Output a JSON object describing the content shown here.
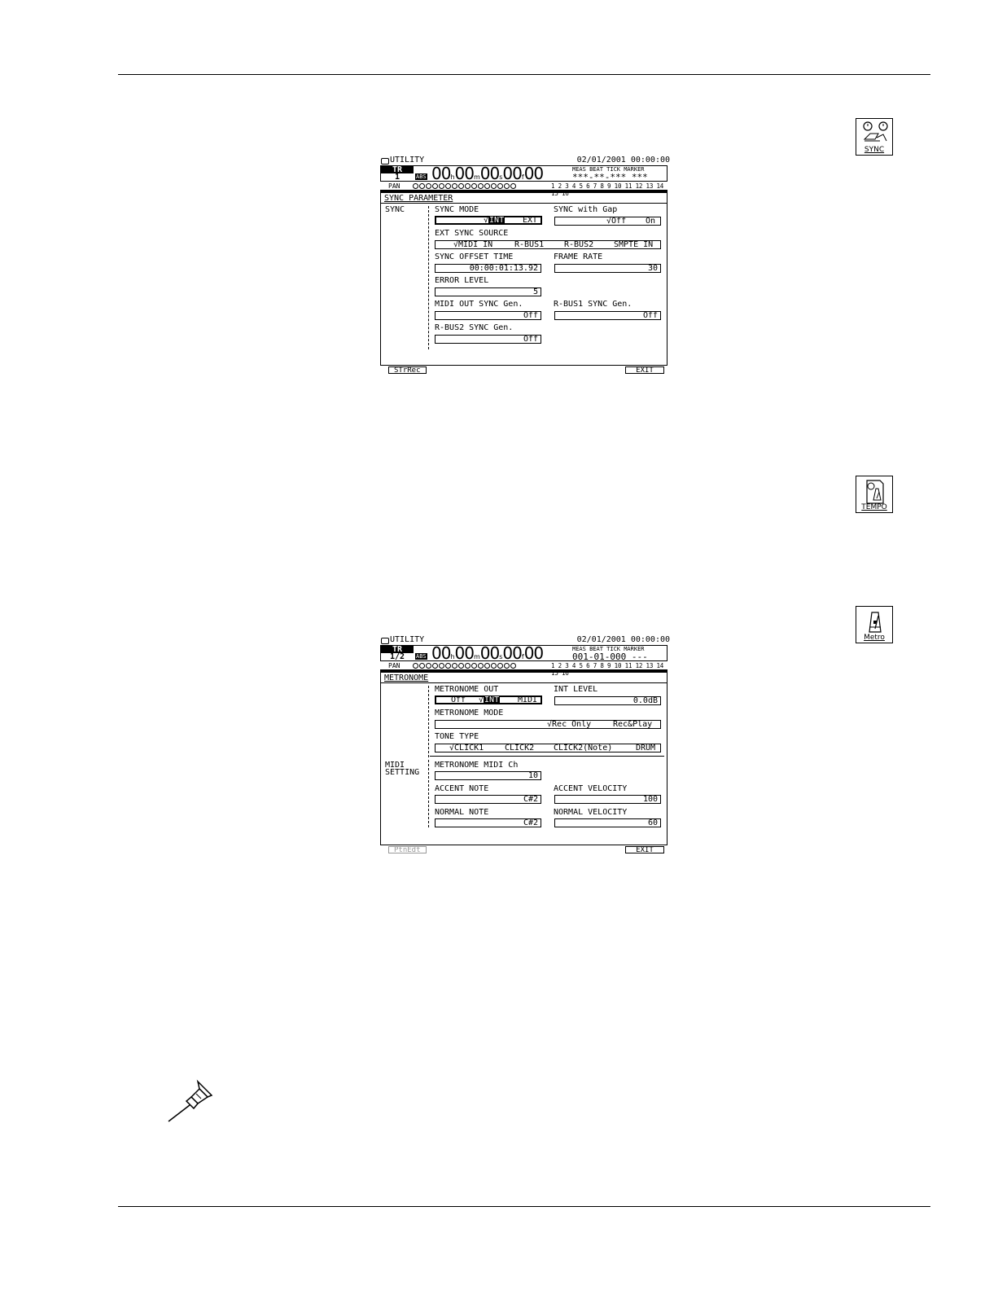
{
  "icons": {
    "sync": {
      "label": "SYNC",
      "icon": "sync-clocks-icon"
    },
    "tempo": {
      "label": "TEMPO",
      "icon": "tempo-map-icon"
    },
    "metro": {
      "label": "Metro",
      "icon": "metronome-icon"
    }
  },
  "screen1": {
    "title": "UTILITY",
    "date": "02/01/2001 00:00:00",
    "tr_label": "TR",
    "tr_num": "1",
    "abs": "ABS",
    "time": {
      "h": "00",
      "m": "00",
      "s": "00",
      "f": "00",
      "sub": "00",
      "h_unit": "h",
      "m_unit": "m",
      "s_unit": "s",
      "f_unit": "f"
    },
    "mbt_labels": "MEAS BEAT TICK MARKER",
    "mbt_value": "***-**-*** ***",
    "pan": "PAN",
    "tracks": "1 2 3 4 5 6 7 8 9 10 11 12 13 14 15 16",
    "panel_title": "SYNC PARAMETER",
    "section": "SYNC",
    "sync_mode": {
      "label": "SYNC MODE",
      "opt1": "INT",
      "opt2": "EXT"
    },
    "sync_gap": {
      "label": "SYNC with Gap",
      "opt1": "Off",
      "opt2": "On"
    },
    "ext_source": {
      "label": "EXT SYNC SOURCE",
      "opt1": "MIDI IN",
      "opt2": "R-BUS1",
      "opt3": "R-BUS2",
      "opt4": "SMPTE IN"
    },
    "offset": {
      "label": "SYNC OFFSET TIME",
      "value": "00:00:01:13.92"
    },
    "frame_rate": {
      "label": "FRAME RATE",
      "value": "30"
    },
    "error_level": {
      "label": "ERROR LEVEL",
      "value": "5"
    },
    "midi_out_gen": {
      "label": "MIDI OUT SYNC Gen.",
      "value": "Off"
    },
    "rbus1_gen": {
      "label": "R-BUS1 SYNC Gen.",
      "value": "Off"
    },
    "rbus2_gen": {
      "label": "R-BUS2 SYNC Gen.",
      "value": "Off"
    },
    "btn_left": "STrRec",
    "btn_right": "EXIT"
  },
  "screen2": {
    "title": "UTILITY",
    "date": "02/01/2001 00:00:00",
    "tr_label": "TR",
    "tr_num": "1/2",
    "abs": "ABS",
    "time": {
      "h": "00",
      "m": "00",
      "s": "00",
      "f": "00",
      "sub": "00",
      "h_unit": "h",
      "m_unit": "m",
      "s_unit": "s",
      "f_unit": "f"
    },
    "mbt_labels": "MEAS BEAT TICK MARKER",
    "mbt_value": "001-01-000 ---",
    "pan": "PAN",
    "tracks": "1 2 3 4 5 6 7 8 9 10 11 12 13 14 15 16",
    "panel_title": "METRONOME",
    "met_out": {
      "label": "METRONOME OUT",
      "opt1": "Off",
      "opt2": "INT",
      "opt3": "MIDI"
    },
    "int_level": {
      "label": "INT LEVEL",
      "value": "0.0dB"
    },
    "met_mode": {
      "label": "METRONOME MODE",
      "opt1": "Rec Only",
      "opt2": "Rec&Play"
    },
    "tone_type": {
      "label": "TONE TYPE",
      "opt1": "CLICK1",
      "opt2": "CLICK2",
      "opt3": "CLICK2(Note)",
      "opt4": "DRUM"
    },
    "section_midi_1": "MIDI",
    "section_midi_2": "SETTING",
    "midi_ch": {
      "label": "METRONOME MIDI Ch",
      "value": "10"
    },
    "accent_note": {
      "label": "ACCENT NOTE",
      "value": "C#2"
    },
    "accent_vel": {
      "label": "ACCENT VELOCITY",
      "value": "100"
    },
    "normal_note": {
      "label": "NORMAL NOTE",
      "value": "C#2"
    },
    "normal_vel": {
      "label": "NORMAL VELOCITY",
      "value": "60"
    },
    "btn_left": "PtnEdt",
    "btn_right": "EXIT"
  },
  "decor": {
    "pin": "pushpin-icon"
  }
}
